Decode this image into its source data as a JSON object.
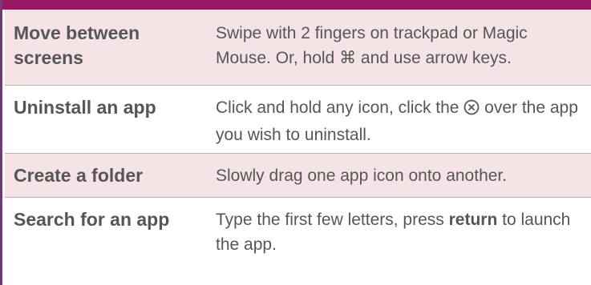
{
  "table": {
    "rows": [
      {
        "label": "Move between screens",
        "desc_part1": "Swipe with 2 fingers on trackpad or Magic Mouse. Or, hold ",
        "desc_symbol": "⌘",
        "desc_part2": " and use arrow keys."
      },
      {
        "label": "Uninstall an app",
        "desc_part1": "Click and hold any icon, click the ",
        "desc_part2": " over the app you wish to uninstall."
      },
      {
        "label": "Create a folder",
        "desc": "Slowly drag one app icon onto another."
      },
      {
        "label": "Search for an app",
        "desc_part1": "Type the first few letters, press ",
        "desc_bold": "return",
        "desc_part2": " to launch the app."
      }
    ]
  },
  "colors": {
    "header": "#9a1764",
    "shaded_row": "#f6e3e5",
    "border": "#6e3b73",
    "text": "#55565b"
  },
  "icons": {
    "delete_icon": "circled-x-icon"
  }
}
